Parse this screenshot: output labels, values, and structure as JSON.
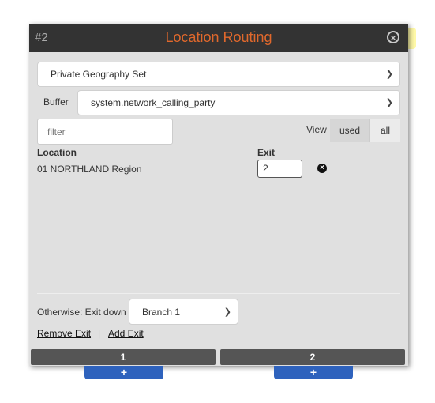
{
  "header": {
    "number": "#2",
    "title": "Location Routing",
    "close_icon": "close-circle-icon"
  },
  "geography_select": {
    "value": "Private Geography Set"
  },
  "buffer": {
    "label": "Buffer",
    "value": "system.network_calling_party"
  },
  "filter": {
    "placeholder": "filter",
    "value": ""
  },
  "view": {
    "label": "View",
    "options": [
      "used",
      "all"
    ],
    "selected": "used"
  },
  "table": {
    "headers": {
      "location": "Location",
      "exit": "Exit"
    },
    "rows": [
      {
        "location": "01 NORTHLAND Region",
        "exit": "2"
      }
    ]
  },
  "otherwise": {
    "label": "Otherwise: Exit down",
    "value": "Branch 1"
  },
  "links": {
    "remove": "Remove Exit",
    "separator": "|",
    "add": "Add Exit"
  },
  "exits": [
    {
      "label": "1",
      "add": "+"
    },
    {
      "label": "2",
      "add": "+"
    }
  ],
  "colors": {
    "title": "#e0682c",
    "header_bg": "#333333",
    "add_button": "#2e62bd"
  }
}
